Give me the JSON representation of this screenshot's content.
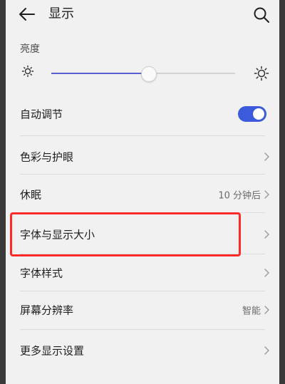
{
  "header": {
    "title": "显示"
  },
  "brightness": {
    "label": "亮度",
    "level_fraction": 0.53
  },
  "settings": [
    {
      "key": "auto_adjust",
      "label": "自动调节",
      "toggle": true
    },
    {
      "key": "color_eye",
      "label": "色彩与护眼",
      "value": ""
    },
    {
      "key": "sleep",
      "label": "休眠",
      "value": "10 分钟后"
    },
    {
      "key": "font_size",
      "label": "字体与显示大小",
      "value": ""
    },
    {
      "key": "font_style",
      "label": "字体样式",
      "value": ""
    },
    {
      "key": "resolution",
      "label": "屏幕分辨率",
      "value": "智能"
    },
    {
      "key": "more",
      "label": "更多显示设置",
      "value": ""
    }
  ],
  "colors": {
    "accent": "#3b5bdb",
    "highlight_box": "#ff2a2a"
  }
}
